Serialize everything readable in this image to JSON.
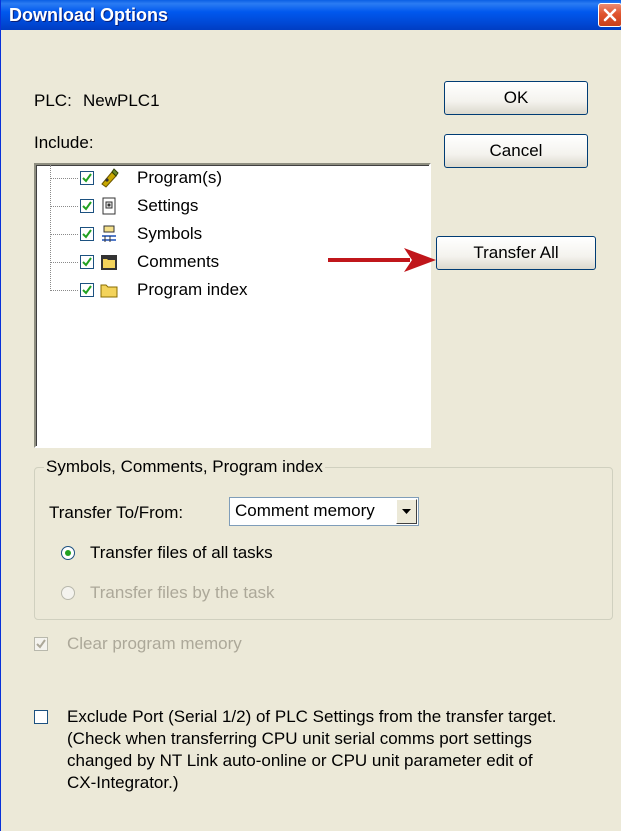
{
  "window": {
    "title": "Download Options",
    "close_icon": "close-icon",
    "accent_color": "#0054e3"
  },
  "plc": {
    "label": "PLC:",
    "name": "NewPLC1"
  },
  "include": {
    "label": "Include:",
    "items": [
      {
        "label": "Program(s)",
        "checked": true,
        "icon": "program-icon"
      },
      {
        "label": "Settings",
        "checked": true,
        "icon": "settings-icon"
      },
      {
        "label": "Symbols",
        "checked": true,
        "icon": "symbols-icon"
      },
      {
        "label": "Comments",
        "checked": true,
        "icon": "comments-icon"
      },
      {
        "label": "Program index",
        "checked": true,
        "icon": "folder-icon"
      }
    ]
  },
  "buttons": {
    "ok": "OK",
    "cancel": "Cancel",
    "transfer_all": "Transfer All"
  },
  "group": {
    "title": "Symbols, Comments, Program index",
    "transfer_label": "Transfer To/From:",
    "transfer_value": "Comment memory",
    "radio_all_tasks": "Transfer files of all tasks",
    "radio_by_task": "Transfer files by the task",
    "radio_all_tasks_selected": true
  },
  "clear_memory": {
    "label": "Clear program memory",
    "checked": true,
    "enabled": false
  },
  "exclude_port": {
    "line1": "Exclude Port (Serial 1/2) of PLC Settings from the transfer target.",
    "line2": "(Check when transferring CPU unit serial comms port settings",
    "line3": "changed by NT Link auto-online or CPU unit parameter edit of",
    "line4": "CX-Integrator.)",
    "checked": false
  },
  "annotation": {
    "arrow_color": "#c0161b"
  }
}
